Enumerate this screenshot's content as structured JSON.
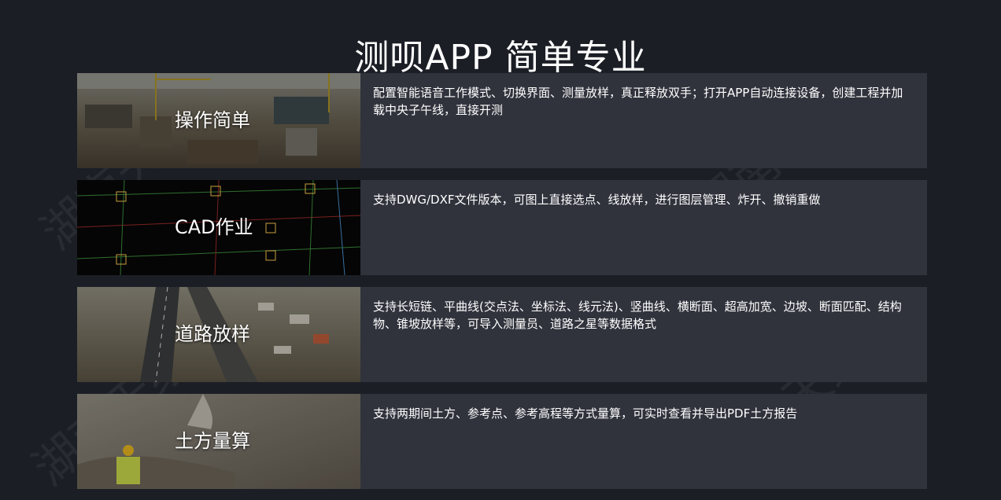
{
  "header": {
    "title": "测呗APP 简单专业"
  },
  "features": [
    {
      "label": "操作简单",
      "description": "配置智能语音工作模式、切换界面、测量放样，真正释放双手；打开APP自动连接设备，创建工程并加载中央子午线，直接开测"
    },
    {
      "label": "CAD作业",
      "description": "支持DWG/DXF文件版本，可图上直接选点、线放样，进行图层管理、炸开、撤销重做"
    },
    {
      "label": "道路放样",
      "description": "支持长短链、平曲线(交点法、坐标法、线元法)、竖曲线、横断面、超高加宽、边坡、断面匹配、结构物、锥坡放样等，可导入测量员、道路之星等数据格式"
    },
    {
      "label": "土方量算",
      "description": "支持两期间土方、参考点、参考高程等方式量算，可实时查看并导出PDF土方报告"
    }
  ],
  "watermark": {
    "text": "湖南天绘"
  },
  "colors": {
    "background": "#1b1e25",
    "card": "#30323c",
    "text": "#ffffff"
  }
}
